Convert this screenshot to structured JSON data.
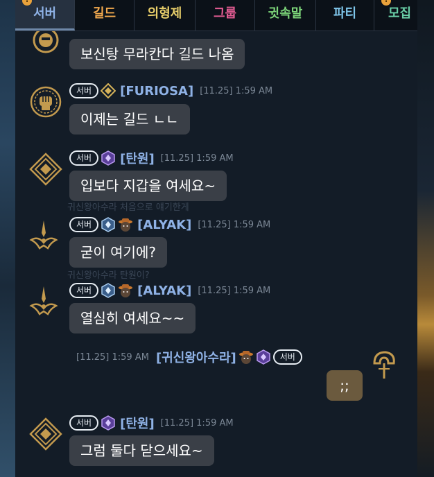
{
  "tabs": [
    {
      "label": "서버",
      "color": "#8fb2e6",
      "active": true
    },
    {
      "label": "길드",
      "color": "#f2a94e"
    },
    {
      "label": "의형제",
      "color": "#e9cf6a"
    },
    {
      "label": "그룹",
      "color": "#e25c92"
    },
    {
      "label": "귓속말",
      "color": "#7dd67a"
    },
    {
      "label": "파티",
      "color": "#7ec4e8"
    },
    {
      "label": "모집",
      "color": "#6ad0a8"
    }
  ],
  "server_badge": "서버",
  "messages": [
    {
      "text": "보신탕 무라칸다  길드 나옴",
      "avatar": "guild-emblem-icon"
    },
    {
      "name": "[FURIOSA]",
      "time": "[11.25] 1:59 AM",
      "text": "이제는 길드 ㄴㄴ",
      "avatar": "fist-emblem-icon"
    },
    {
      "name": "[탄원]",
      "time": "[11.25] 1:59 AM",
      "text": "입보다 지갑을 여세요~",
      "avatar": "diamond-emblem-icon"
    },
    {
      "name": "[ALYAK]",
      "time": "[11.25] 1:59 AM",
      "text": "굳이 여기에?",
      "avatar": "crown-emblem-icon"
    },
    {
      "name": "[ALYAK]",
      "time": "[11.25] 1:59 AM",
      "text": "열심히 여세요~~",
      "avatar": "crown-emblem-icon"
    },
    {
      "name": "[귀신왕아수라]",
      "time": "[11.25] 1:59 AM",
      "text": ";;",
      "avatar": "helmet-emblem-icon"
    },
    {
      "name": "[탄원]",
      "time": "[11.25] 1:59 AM",
      "text": "그럼 둘다 닫으세요~",
      "avatar": "diamond-emblem-icon"
    }
  ],
  "background_ghost": [
    "귀신왕아수라 처음으로 얘기한게",
    "귀신왕아수라 탄원이?"
  ]
}
